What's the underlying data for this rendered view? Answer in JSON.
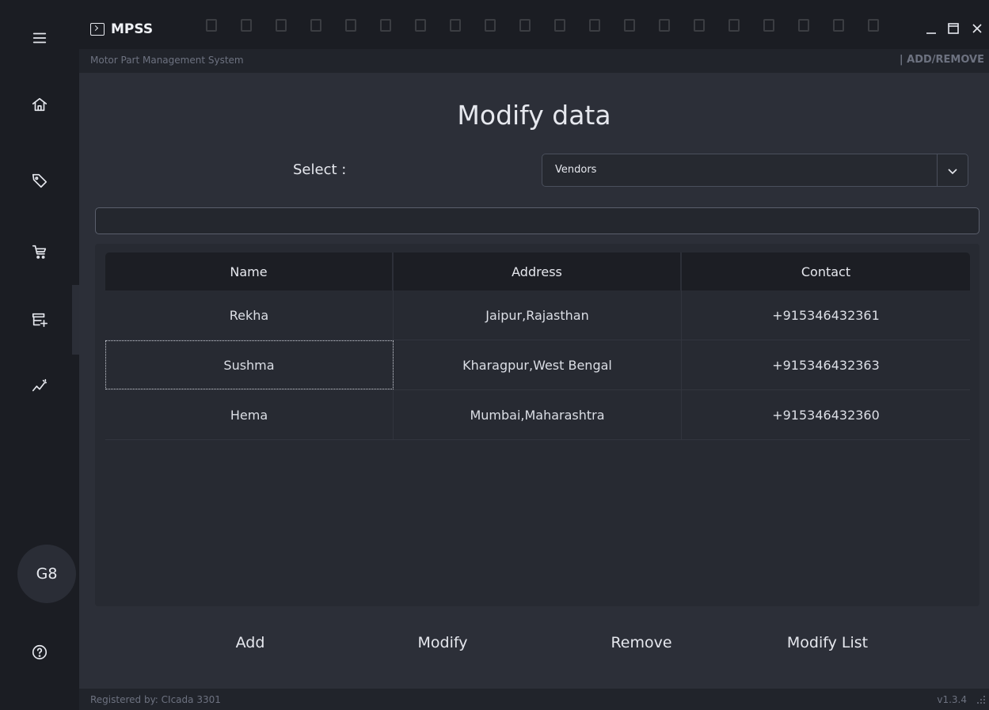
{
  "app": {
    "title": "MPSS",
    "subtitle": "Motor Part Management System",
    "section": "| ADD/REMOVE"
  },
  "sidebar": {
    "items": [
      {
        "name": "menu",
        "icon": "hamburger-menu-icon"
      },
      {
        "name": "home",
        "icon": "home-icon"
      },
      {
        "name": "tags",
        "icon": "tag-icon"
      },
      {
        "name": "cart",
        "icon": "cart-icon"
      },
      {
        "name": "store-add",
        "icon": "store-add-icon",
        "active": true
      },
      {
        "name": "analytics",
        "icon": "sparkline-icon"
      }
    ],
    "avatar": "G8",
    "help_icon": "help-icon"
  },
  "main": {
    "title": "Modify data",
    "select_label": "Select :",
    "select_value": "Vendors",
    "search_value": "",
    "table": {
      "columns": [
        "Name",
        "Address",
        "Contact"
      ],
      "rows": [
        [
          "Rekha",
          "Jaipur,Rajasthan",
          "+915346432361"
        ],
        [
          "Sushma",
          "Kharagpur,West Bengal",
          "+915346432363"
        ],
        [
          "Hema",
          "Mumbai,Maharashtra",
          "+915346432360"
        ]
      ]
    },
    "buttons": {
      "add": "Add",
      "modify": "Modify",
      "remove": "Remove",
      "modify_list": "Modify List"
    }
  },
  "status": {
    "left": "Registered by: CIcada 3301",
    "version": "v1.3.4"
  },
  "colors": {
    "background": "#1b1d23",
    "panel": "#2c2f38",
    "table_header": "#1c1e24",
    "text": "#e6e8ee",
    "muted": "#6d7280"
  }
}
